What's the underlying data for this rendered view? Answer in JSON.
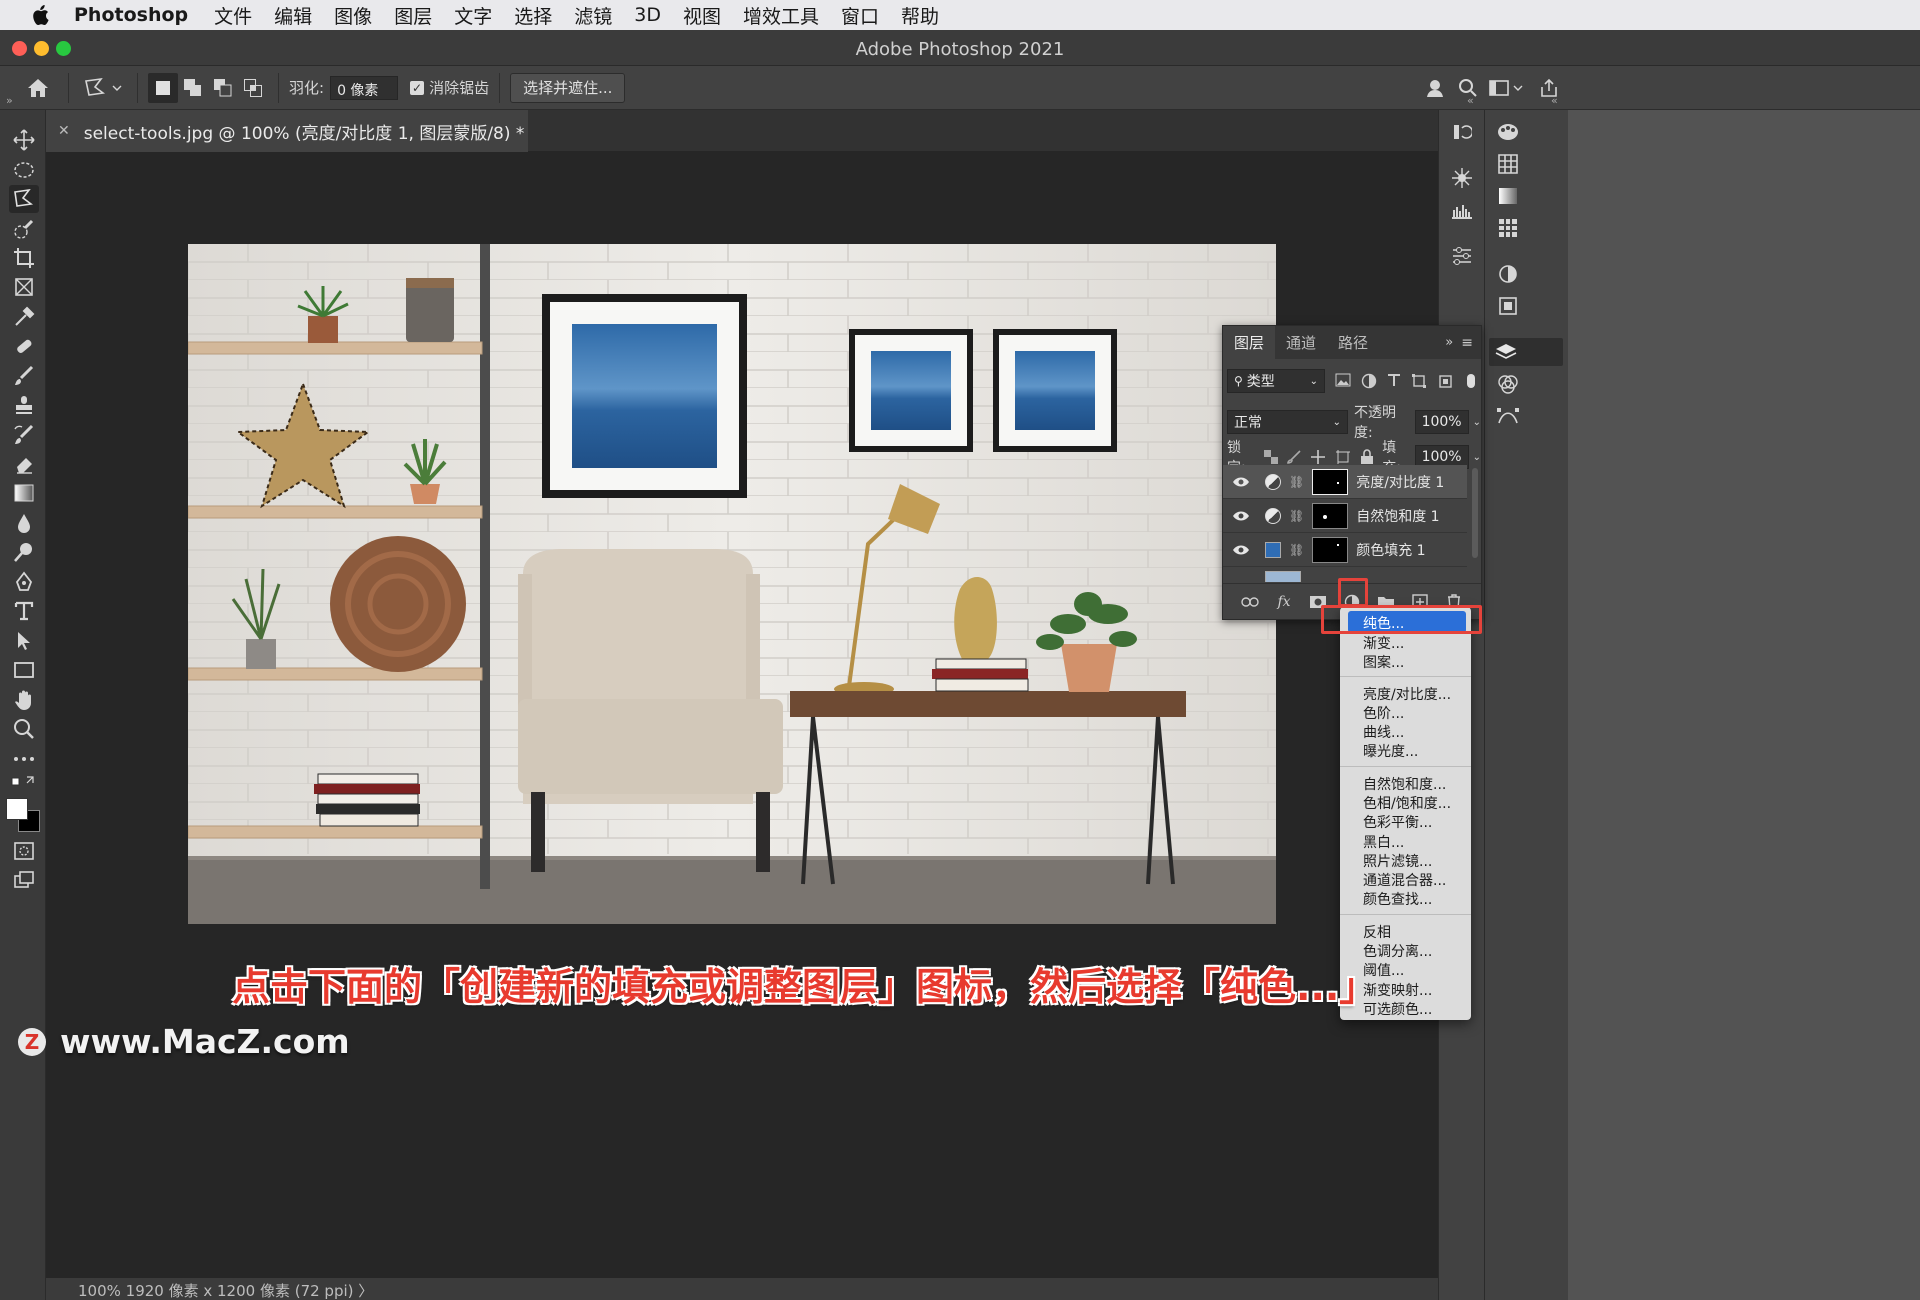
{
  "menubar": {
    "app": "Photoshop",
    "items": [
      "文件",
      "编辑",
      "图像",
      "图层",
      "文字",
      "选择",
      "滤镜",
      "3D",
      "视图",
      "增效工具",
      "窗口",
      "帮助"
    ]
  },
  "window": {
    "title": "Adobe Photoshop 2021"
  },
  "options": {
    "feather_label": "羽化:",
    "feather_value": "0 像素",
    "antialias_label": "消除锯齿",
    "select_mask_button": "选择并遮住..."
  },
  "document": {
    "tab_title": "select-tools.jpg @ 100% (亮度/对比度 1, 图层蒙版/8) *",
    "status": "100%     1920 像素 x 1200 像素 (72 ppi)  〉"
  },
  "layers_panel": {
    "tabs": [
      "图层",
      "通道",
      "路径"
    ],
    "filter_label": "类型",
    "blend_mode": "正常",
    "opacity_label": "不透明度:",
    "opacity_value": "100%",
    "lock_label": "锁定:",
    "fill_label": "填充:",
    "fill_value": "100%",
    "layers": [
      {
        "name": "亮度/对比度 1",
        "type": "adjustment",
        "selected": true
      },
      {
        "name": "自然饱和度 1",
        "type": "adjustment",
        "selected": false
      },
      {
        "name": "颜色填充 1",
        "type": "fill",
        "swatch": "#2f6db5",
        "selected": false
      }
    ]
  },
  "dropdown": {
    "groups": [
      [
        "纯色...",
        "渐变...",
        "图案..."
      ],
      [
        "亮度/对比度...",
        "色阶...",
        "曲线...",
        "曝光度..."
      ],
      [
        "自然饱和度...",
        "色相/饱和度...",
        "色彩平衡...",
        "黑白...",
        "照片滤镜...",
        "通道混合器...",
        "颜色查找..."
      ],
      [
        "反相",
        "色调分离...",
        "阈值...",
        "渐变映射...",
        "可选颜色..."
      ]
    ],
    "highlighted": "纯色..."
  },
  "caption": "点击下面的「创建新的填充或调整图层」图标，然后选择「纯色...」",
  "watermark": "www.MacZ.com",
  "colors": {
    "accent": "#2b6fd8",
    "highlight_red": "#e5433b",
    "caption_red": "#e83a2e"
  }
}
